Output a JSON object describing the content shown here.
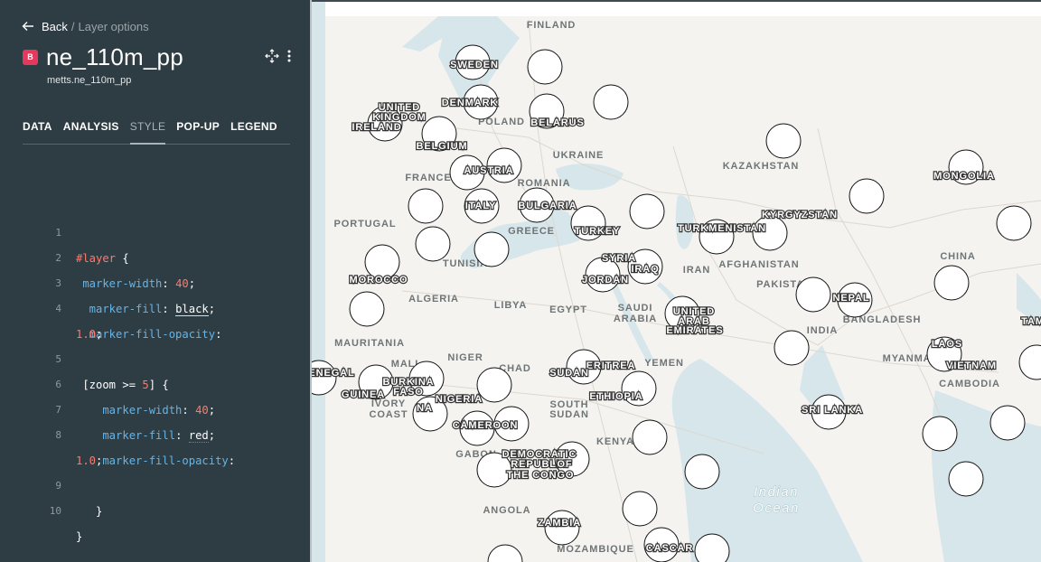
{
  "nav": {
    "back_label": "Back",
    "separator": "/",
    "crumb": "Layer options"
  },
  "layer": {
    "badge": "B",
    "title": "ne_110m_pp",
    "subtitle": "metts.ne_110m_pp"
  },
  "icons": {
    "back": "arrow-left-icon",
    "move": "move-arrows-icon",
    "more": "more-vertical-icon"
  },
  "tabs": [
    {
      "label": "DATA"
    },
    {
      "label": "ANALYSIS"
    },
    {
      "label": "STYLE",
      "active": true
    },
    {
      "label": "POP-UP"
    },
    {
      "label": "LEGEND"
    }
  ],
  "code": {
    "l1": {
      "num": "1",
      "sel": "#layer",
      "rest": " {"
    },
    "l2": {
      "num": "2",
      "prop": " marker-width",
      "sep": ": ",
      "val": "40",
      "end": ";"
    },
    "l3": {
      "num": "3",
      "prop": "  marker-fill",
      "sep": ": ",
      "val": "black",
      "end": ";"
    },
    "l4": {
      "num": "4",
      "prop": "  marker-fill-opacity",
      "end": ":"
    },
    "l4w": {
      "val": "1.0",
      "end": ";"
    },
    "l5": {
      "num": "5",
      "pre": " [zoom >= ",
      "val": "5",
      "post": "] {"
    },
    "l6": {
      "num": "6",
      "prop": "    marker-width",
      "sep": ": ",
      "val": "40",
      "end": ";"
    },
    "l7": {
      "num": "7",
      "prop": "    marker-fill",
      "sep": ": ",
      "val": "red",
      "end": ";"
    },
    "l8": {
      "num": "8",
      "prop": "    marker-fill-opacity",
      "end": ":"
    },
    "l8w": {
      "val": "1.0",
      "end": ";"
    },
    "l9": {
      "num": "9",
      "text": "   }"
    },
    "l10": {
      "num": "10",
      "text": "}"
    }
  },
  "colors": {
    "panel": "#2e3c43",
    "map_land": "#f5f3ef",
    "water": "#d6e6ea",
    "accent_badge": "#e5385d",
    "marker_fill": "#ffffff"
  },
  "map": {
    "labels": {
      "finland": "FINLAND",
      "sweden": "SWEDEN",
      "denmark": "DENMARK",
      "united_kingdom_1": "UNITED",
      "united_kingdom_2": "KINGDOM",
      "ireland": "IRELAND",
      "poland": "POLAND",
      "belarus": "BELARUS",
      "belgium": "BELGIUM",
      "ukraine": "UKRAINE",
      "france": "FRANCE",
      "austria": "AUSTRIA",
      "romania": "ROMANIA",
      "kazakhstan": "KAZAKHSTAN",
      "mongolia": "MONGOLIA",
      "italy": "ITALY",
      "bulgaria": "BULGARIA",
      "greece": "GREECE",
      "turkey": "TURKEY",
      "portugal": "PORTUGAL",
      "turkmenistan": "TURKMENISTAN",
      "kyrgyzstan": "KYRGYZSTAN",
      "tunisia": "TUNISIA",
      "morocco": "MOROCCO",
      "syria": "SYRIA",
      "iraq": "IRAQ",
      "iran": "IRAN",
      "jordan": "JORDAN",
      "afghanistan": "AFGHANISTAN",
      "china": "CHINA",
      "algeria": "ALGERIA",
      "libya": "LIBYA",
      "egypt": "EGYPT",
      "saudi_1": "SAUDI",
      "saudi_2": "ARABIA",
      "pakistan": "PAKISTAN",
      "nepal": "NEPAL",
      "uae_1": "UNITED",
      "uae_2": "ARAB",
      "uae_3": "EMIRATES",
      "india": "INDIA",
      "bangladesh": "BANGLADESH",
      "mauritania": "MAURITANIA",
      "mali": "MALI",
      "niger": "NIGER",
      "chad": "CHAD",
      "eritrea": "ERITREA",
      "yemen": "YEMEN",
      "myanmar": "MYANMAR",
      "laos": "LAOS",
      "vietnam": "VIETNAM",
      "senegal": "ENEGAL",
      "guinea": "GUINEA",
      "burkina_1": "BURKINA",
      "burkina_2": "FASO",
      "ivory_1": "IVORY",
      "ivory_2": "COAST",
      "ghana": "NA",
      "nigeria": "NIGERIA",
      "sudan": "SUDAN",
      "south_sudan_1": "SOUTH",
      "south_sudan_2": "SUDAN",
      "ethiopia": "ETHIOPIA",
      "cambodia": "CAMBODIA",
      "sri_lanka": "SRI LANKA",
      "cameroon": "CAMEROON",
      "gabon": "GABON",
      "drc_1": "DEMOCRATIC",
      "drc_2": "REPUBLIC",
      "drc_3": "OF",
      "drc_4": "THE CONGO",
      "kenya": "KENYA",
      "angola": "ANGOLA",
      "zambia": "ZAMBIA",
      "mozambique": "MOZAMBIQUE",
      "madagascar": "CASCAR",
      "tam": "TAM",
      "ocean_1": "Indian",
      "ocean_2": "Ocean"
    }
  }
}
